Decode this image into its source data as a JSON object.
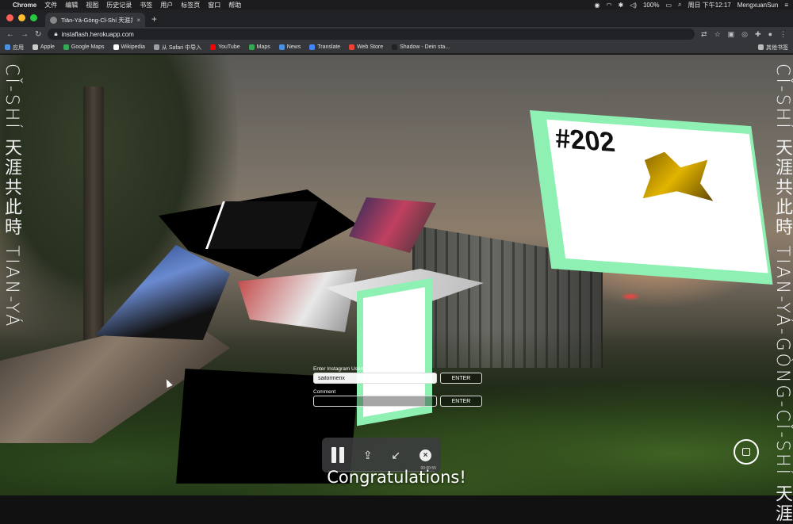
{
  "menubar": {
    "app_name": "Chrome",
    "menus": [
      "文件",
      "编辑",
      "视图",
      "历史记录",
      "书签",
      "用户",
      "标签页",
      "窗口",
      "帮助"
    ],
    "battery": "100%",
    "datetime": "周日 下午12:17",
    "username": "MengxuanSun"
  },
  "tab": {
    "title": "Tiān-Yá-Gòng-Cǐ-Shí 天涯共此",
    "close": "×",
    "new_tab": "+"
  },
  "toolbar": {
    "url": "instaflash.herokuapp.com"
  },
  "bookmarks": [
    {
      "label": "应用",
      "color": "#4a90e2"
    },
    {
      "label": "Apple",
      "color": "#cccccc"
    },
    {
      "label": "Google Maps",
      "color": "#34a853"
    },
    {
      "label": "Wikipedia",
      "color": "#ffffff"
    },
    {
      "label": "从 Safari 中导入",
      "color": "#9aa0a6"
    },
    {
      "label": "YouTube",
      "color": "#ff0000"
    },
    {
      "label": "Maps",
      "color": "#34a853"
    },
    {
      "label": "News",
      "color": "#4a90e2"
    },
    {
      "label": "Translate",
      "color": "#4285f4"
    },
    {
      "label": "Web Store",
      "color": "#ea4335"
    },
    {
      "label": "Shadow - Dein sta...",
      "color": "#222222"
    }
  ],
  "bookmarks_other": "其他书签",
  "side_text": {
    "left": "CǏ-SHÍ 天涯共此時 TIAN-YÁ",
    "right": "CǏ-SHÍ 天涯共此時 TIAN-YÁ-GÒNG-CǏ-SHÍ 天涯"
  },
  "poster": {
    "hash": "#202"
  },
  "form": {
    "instagram_label": "Enter Instagram Username",
    "instagram_value": "sailormenx",
    "instagram_button": "ENTER",
    "comment_label": "Comment",
    "comment_value": "",
    "comment_button": "ENTER"
  },
  "recorder": {
    "time": "00:00:55"
  },
  "congrats": "Congratulations!"
}
